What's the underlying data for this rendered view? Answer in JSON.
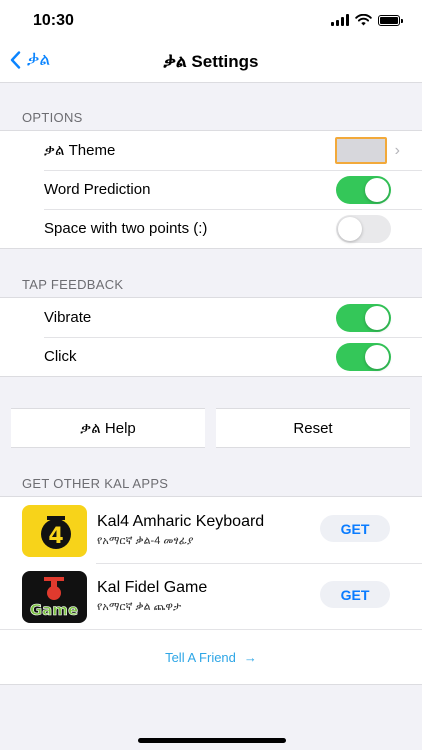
{
  "status": {
    "time": "10:30"
  },
  "nav": {
    "back_label": "ቃል",
    "title": "ቃል Settings"
  },
  "options": {
    "header": "OPTIONS",
    "theme_label": "ቃል Theme",
    "theme_color": "#d7d7dc",
    "word_prediction_label": "Word Prediction",
    "word_prediction_on": true,
    "space_label": "Space with two points (:)",
    "space_on": false
  },
  "tap_feedback": {
    "header": "TAP FEEDBACK",
    "vibrate_label": "Vibrate",
    "vibrate_on": true,
    "click_label": "Click",
    "click_on": true
  },
  "actions": {
    "help_label": "ቃል Help",
    "reset_label": "Reset"
  },
  "apps": {
    "header": "GET OTHER KAL APPS",
    "items": [
      {
        "name": "Kal4 Amharic Keyboard",
        "subtitle": "የአማርኛ ቃል-4 መፃፊያ",
        "button": "GET",
        "icon": "kal4-app-icon",
        "icon_text": "4"
      },
      {
        "name": "Kal Fidel Game",
        "subtitle": "የአማርኛ ቃል ጨዋታ",
        "button": "GET",
        "icon": "kal-game-app-icon",
        "icon_text": "Game"
      }
    ],
    "tell_friend_label": "Tell A Friend",
    "tell_friend_arrow": "→"
  },
  "colors": {
    "accent": "#0a84ff",
    "toggle_on": "#34c759",
    "link": "#2ea6e6"
  }
}
